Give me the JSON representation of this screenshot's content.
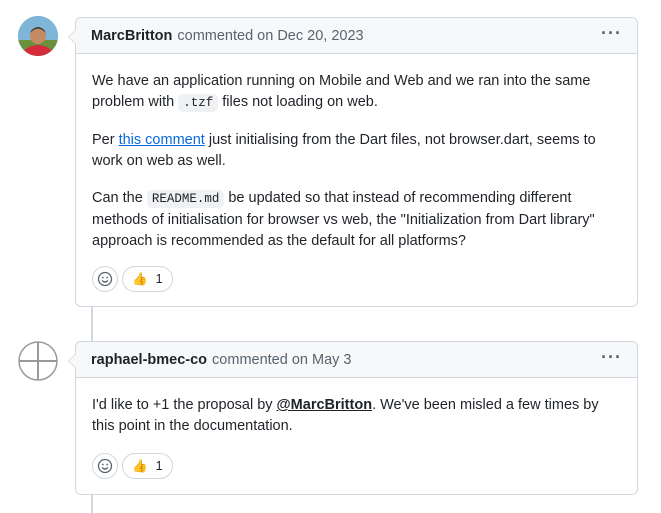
{
  "comments": [
    {
      "author": "MarcBritton",
      "meta": "commented on Dec 20, 2023",
      "menu_glyph": "···",
      "avatar_icon": "user-photo-avatar",
      "p1_a": "We have an application running on Mobile and Web and we ran into the same problem with ",
      "p1_code": ".tzf",
      "p1_b": " files not loading on web.",
      "p2_a": "Per ",
      "p2_link": "this comment",
      "p2_b": " just initialising from the Dart files, not browser.dart, seems to work on web as well.",
      "p3_a": "Can the ",
      "p3_code": "README.md",
      "p3_b": " be updated so that instead of recommending different methods of initialisation for browser vs web, the \"Initialization from Dart library\" approach is recommended as the default for all platforms?",
      "reaction_emoji": "👍",
      "reaction_count": "1"
    },
    {
      "author": "raphael-bmec-co",
      "meta": "commented on May 3",
      "menu_glyph": "···",
      "avatar_icon": "identicon-avatar",
      "p1_a": "I'd like to +1 the proposal by ",
      "p1_mention": "@MarcBritton",
      "p1_b": ". We've been misled a few times by this point in the documentation.",
      "reaction_emoji": "👍",
      "reaction_count": "1"
    }
  ]
}
